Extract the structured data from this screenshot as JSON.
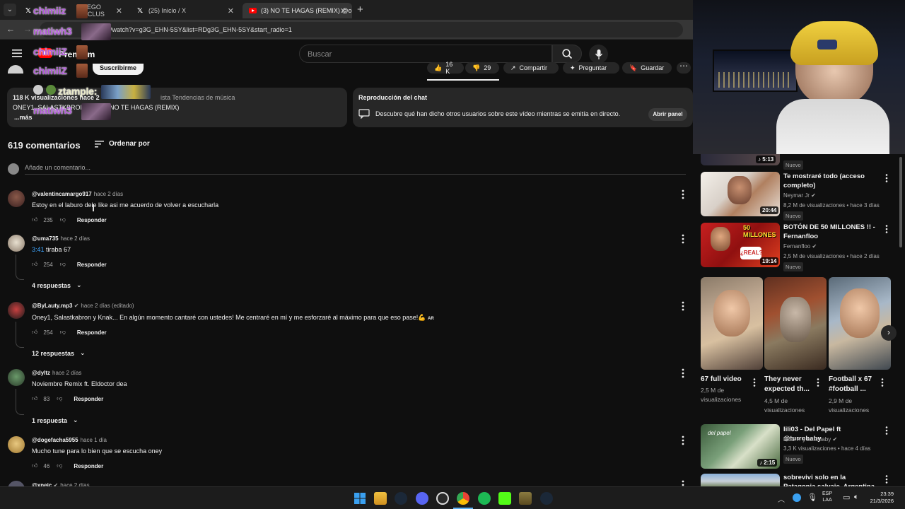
{
  "browser": {
    "tabs": [
      {
        "label": "JUEGO EXCLUS",
        "icon": "x"
      },
      {
        "label": "(25) Inicio / X",
        "icon": "x"
      },
      {
        "label": "(3) NO TE HAGAS (REMIX) @o",
        "icon": "youtube"
      }
    ],
    "url": "/watch?v=g3G_EHN-5SY&list=RDg3G_EHN-5SY&start_radio=1",
    "new_tab": "+"
  },
  "youtube": {
    "logo_text": "Premium",
    "search_placeholder": "Buscar",
    "subscribe_label": "Suscribirme",
    "likes": "16 K",
    "dislikes": "29",
    "share_label": "Compartir",
    "ask_label": "Preguntar",
    "save_label": "Guardar",
    "views_line": "118 K visualizaciones  hace 2",
    "playlist_text": "ista Tendencias de música",
    "artists_line": "ONEY1, SALASTKBRON",
    "song_line": "NO TE HAGAS (REMIX)",
    "more_label": "...más",
    "chat_replay_title": "Reproducción del chat",
    "chat_replay_desc": "Descubre qué han dicho otros usuarios sobre este vídeo mientras se emitía en directo.",
    "open_panel_label": "Abrir panel",
    "comments_count": "619 comentarios",
    "sort_label": "Ordenar por",
    "add_comment_placeholder": "Añade un comentario...",
    "reply_label": "Responder"
  },
  "overlays": [
    "chimiiz",
    "matiwh3",
    "chimiiZ",
    "chimiiZ",
    "ztample:",
    "matiwh3"
  ],
  "comments": [
    {
      "user": "@valentincamargo917",
      "time": "hace 2 días",
      "text": "Estoy en el laburo dele like asi me acuerdo de volver a escucharla",
      "likes": "235",
      "replies": ""
    },
    {
      "user": "@uma735",
      "time": "hace 2 días",
      "timestamp_link": "3:41",
      "text": "tiraba 67",
      "likes": "254",
      "replies": "4 respuestas"
    },
    {
      "user": "@ByLauty.mp3",
      "time": "hace 2 días (editado)",
      "text": "Oney1, Salastkabron y Knak... En algún momento cantaré con ustedes! Me centraré en mí y me esforzaré al máximo para que eso pase!💪",
      "tag": "AR",
      "likes": "254",
      "replies": "12 respuestas"
    },
    {
      "user": "@dyltz",
      "time": "hace 2 días",
      "text": "Noviembre Remix ft. Eldoctor dea",
      "likes": "83",
      "replies": "1 respuesta"
    },
    {
      "user": "@dogefacha5955",
      "time": "hace 1 día",
      "text": "Mucho tune para lo bien que se escucha oney",
      "likes": "46",
      "replies": ""
    },
    {
      "user": "@xneic",
      "time": "hace 2 días",
      "text": "",
      "likes": "",
      "replies": ""
    }
  ],
  "sidebar": {
    "top_partial": {
      "duration": "5:13",
      "badge": "Nuevo"
    },
    "videos": [
      {
        "title": "Te mostraré todo (acceso completo)",
        "channel": "Neymar Jr",
        "meta": "8,2 M de visualizaciones • hace 3 días",
        "badge": "Nuevo",
        "duration": "20:44"
      },
      {
        "title": "BOTÓN DE 50 MILLONES !! - Fernanfloo",
        "channel": "Fernanfloo",
        "meta": "2,5 M de visualizaciones • hace 2 días",
        "badge": "Nuevo",
        "duration": "19:14",
        "thumb_text": "50 MILLONES",
        "thumb_text2": "¿REAL?"
      },
      {
        "title": "lili03 - Del Papel ft @turrobaby",
        "channel": "lili03",
        "channel2": "y turrobaby",
        "meta": "3,3 K visualizaciones • hace 4 días",
        "badge": "Nuevo",
        "duration": "2:15",
        "thumb_text": "del papel"
      },
      {
        "title": "sobrevivi solo en la Patagonia salvaje, Argentina",
        "channel": "",
        "meta": "",
        "badge": "",
        "duration": ""
      }
    ],
    "shorts": [
      {
        "title": "67 full video",
        "meta": "2,5 M de visualizaciones"
      },
      {
        "title": "They never expected th...",
        "meta": "4,5 M de visualizaciones"
      },
      {
        "title": "Football x 67 #football ...",
        "meta": "2,9 M de visualizaciones"
      }
    ]
  },
  "taskbar": {
    "lang": "ESP",
    "lang2": "LAA",
    "time": "23:39",
    "date": "21/3/2026"
  },
  "colors": {
    "background": "#0f0f0f",
    "overlay_name": "#b05ad8",
    "link": "#3ea6ff",
    "youtube_red": "#ff0000"
  }
}
